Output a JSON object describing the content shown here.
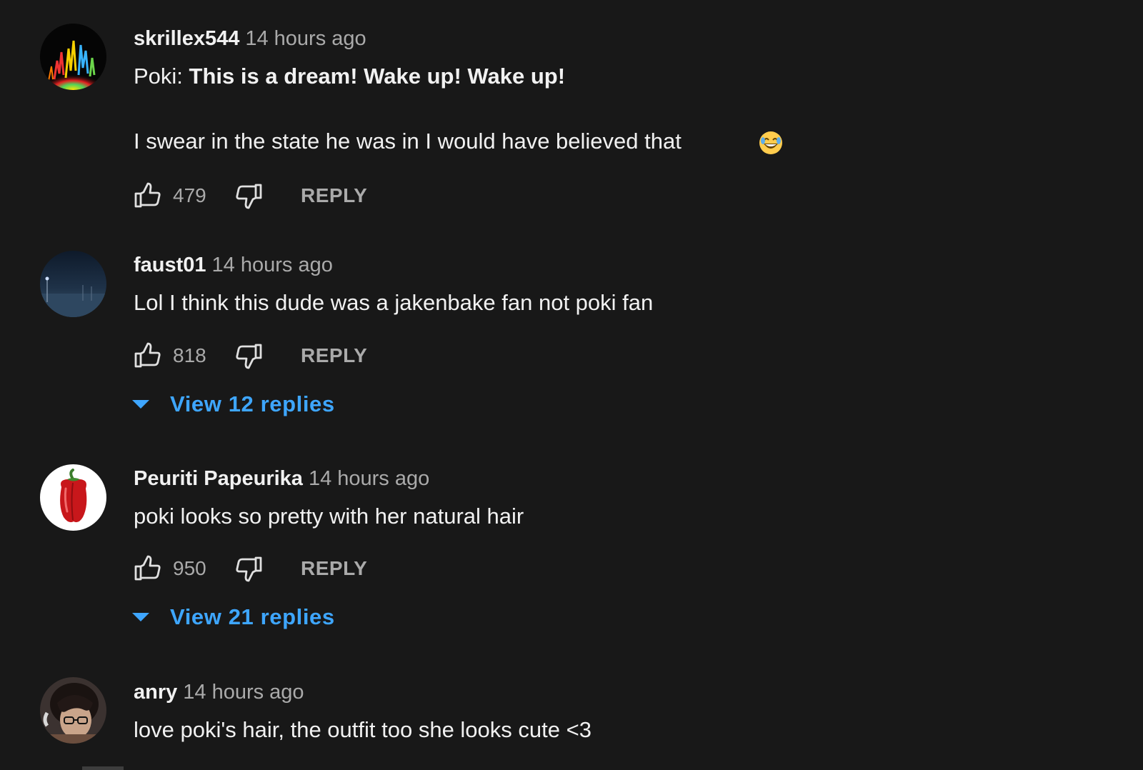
{
  "comments": [
    {
      "author": "skrillex544",
      "time": "14 hours ago",
      "speaker": "Poki: ",
      "quote": "This is a dream! Wake up! Wake up!",
      "line2": "I swear in the state he was in I would have believed that",
      "emoji_icon": "joy-emoji-icon",
      "likes": "479",
      "reply_label": "REPLY"
    },
    {
      "author": "faust01",
      "time": "14 hours ago",
      "text": "Lol I think this dude was a jakenbake fan not poki fan",
      "likes": "818",
      "reply_label": "REPLY",
      "view_replies": "View 12 replies"
    },
    {
      "author": "Peuriti Papeurika",
      "time": "14 hours ago",
      "text": "poki looks so pretty with her natural hair",
      "likes": "950",
      "reply_label": "REPLY",
      "view_replies": "View 21 replies"
    },
    {
      "author": "anry",
      "time": "14 hours ago",
      "text": "love poki's hair, the outfit too she looks cute <3"
    }
  ],
  "icons": {
    "like": "thumbs-up-icon",
    "dislike": "thumbs-down-icon",
    "expand": "caret-down-icon"
  },
  "colors": {
    "background": "#181818",
    "text_primary": "#f1f1f1",
    "text_secondary": "#aaaaaa",
    "link_blue": "#3ea6ff"
  }
}
